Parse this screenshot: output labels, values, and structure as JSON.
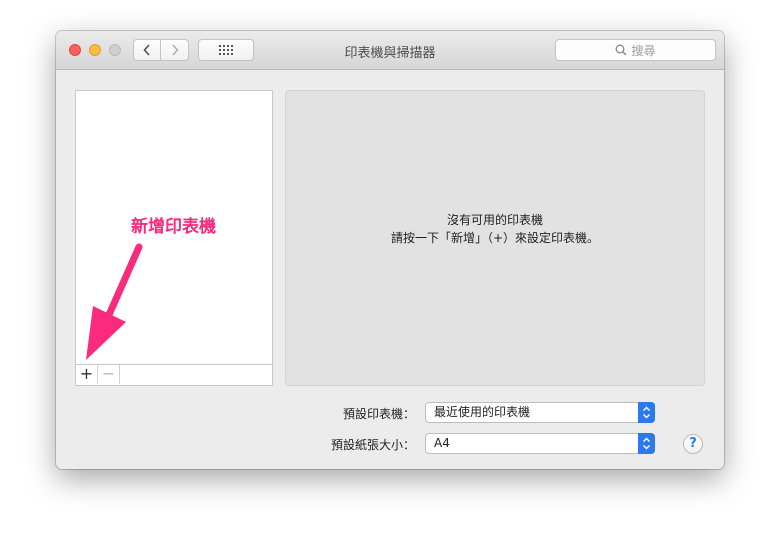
{
  "window": {
    "title": "印表機與掃描器"
  },
  "search": {
    "placeholder": "搜尋"
  },
  "list": {
    "add_label": "+",
    "remove_label": "−"
  },
  "detail": {
    "line1": "沒有可用的印表機",
    "line2": "請按一下「新增」（+）來設定印表機。"
  },
  "settings": {
    "default_printer_label": "預設印表機：",
    "default_printer_value": "最近使用的印表機",
    "default_paper_label": "預設紙張大小：",
    "default_paper_value": "A4"
  },
  "help": {
    "label": "?"
  },
  "annotation": {
    "text": "新增印表機",
    "color": "#fa2a7e"
  },
  "colors": {
    "accent": "#2a79ee"
  }
}
